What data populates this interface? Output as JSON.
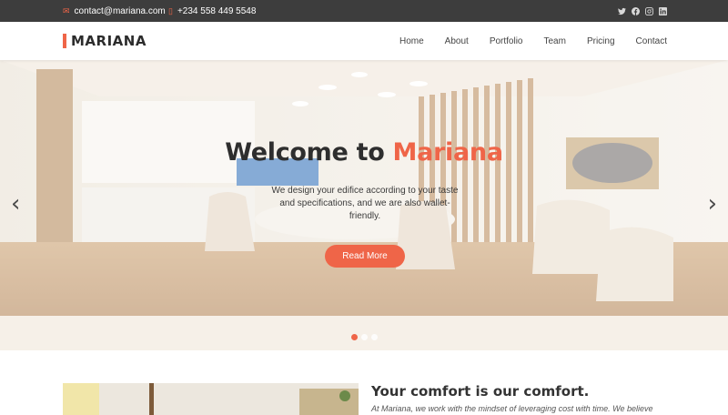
{
  "topbar": {
    "email": "contact@mariana.com",
    "email_icon": "envelope-icon",
    "phone": "+234 558 449 5548",
    "phone_icon": "phone-icon",
    "socials": [
      "twitter-icon",
      "facebook-icon",
      "instagram-icon",
      "linkedin-icon"
    ]
  },
  "header": {
    "logo": "MARIANA",
    "nav": [
      "Home",
      "About",
      "Portfolio",
      "Team",
      "Pricing",
      "Contact"
    ]
  },
  "hero": {
    "title_prefix": "Welcome to ",
    "title_accent": "Mariana",
    "subtitle": "We design your edifice according to your taste and specifications, and we are also wallet-friendly.",
    "button": "Read More",
    "prev_icon": "chevron-left-icon",
    "next_icon": "chevron-right-icon",
    "slides": 3,
    "active_slide": 1
  },
  "about": {
    "title": "Your comfort is our comfort.",
    "text": "At Mariana, we work with the mindset of leveraging cost with time. We believe"
  },
  "colors": {
    "accent": "#ef6548",
    "topbar": "#3d3d3d"
  }
}
